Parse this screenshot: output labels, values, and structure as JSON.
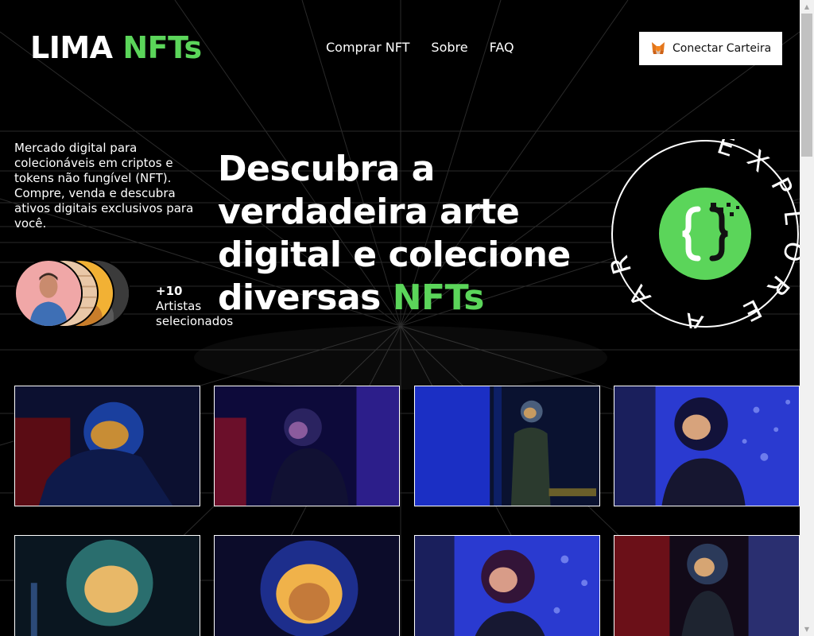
{
  "header": {
    "logo_main": "LIMA ",
    "logo_accent": "NFTs",
    "nav": [
      "Comprar NFT",
      "Sobre",
      "FAQ"
    ],
    "connect_label": "Conectar Carteira"
  },
  "hero": {
    "description": "Mercado digital para colecionáveis em criptos e tokens não fungível (NFT). Compre, venda e descubra ativos digitais exclusivos para você.",
    "artists_count": "+10",
    "artists_label": "Artistas selecionados",
    "headline_main": "Descubra a verdadeira arte digital e colecione diversas ",
    "headline_accent": "NFTs",
    "badge_text": "EXPLORE A ARTE"
  },
  "gallery": {
    "items": [
      "nft-card-1",
      "nft-card-2",
      "nft-card-3",
      "nft-card-4",
      "nft-card-5",
      "nft-card-6",
      "nft-card-7",
      "nft-card-8"
    ]
  },
  "colors": {
    "accent": "#5bd55a",
    "background": "#000000"
  },
  "icons": {
    "wallet": "metamask-fox-icon",
    "badge": "code-brackets-icon"
  }
}
